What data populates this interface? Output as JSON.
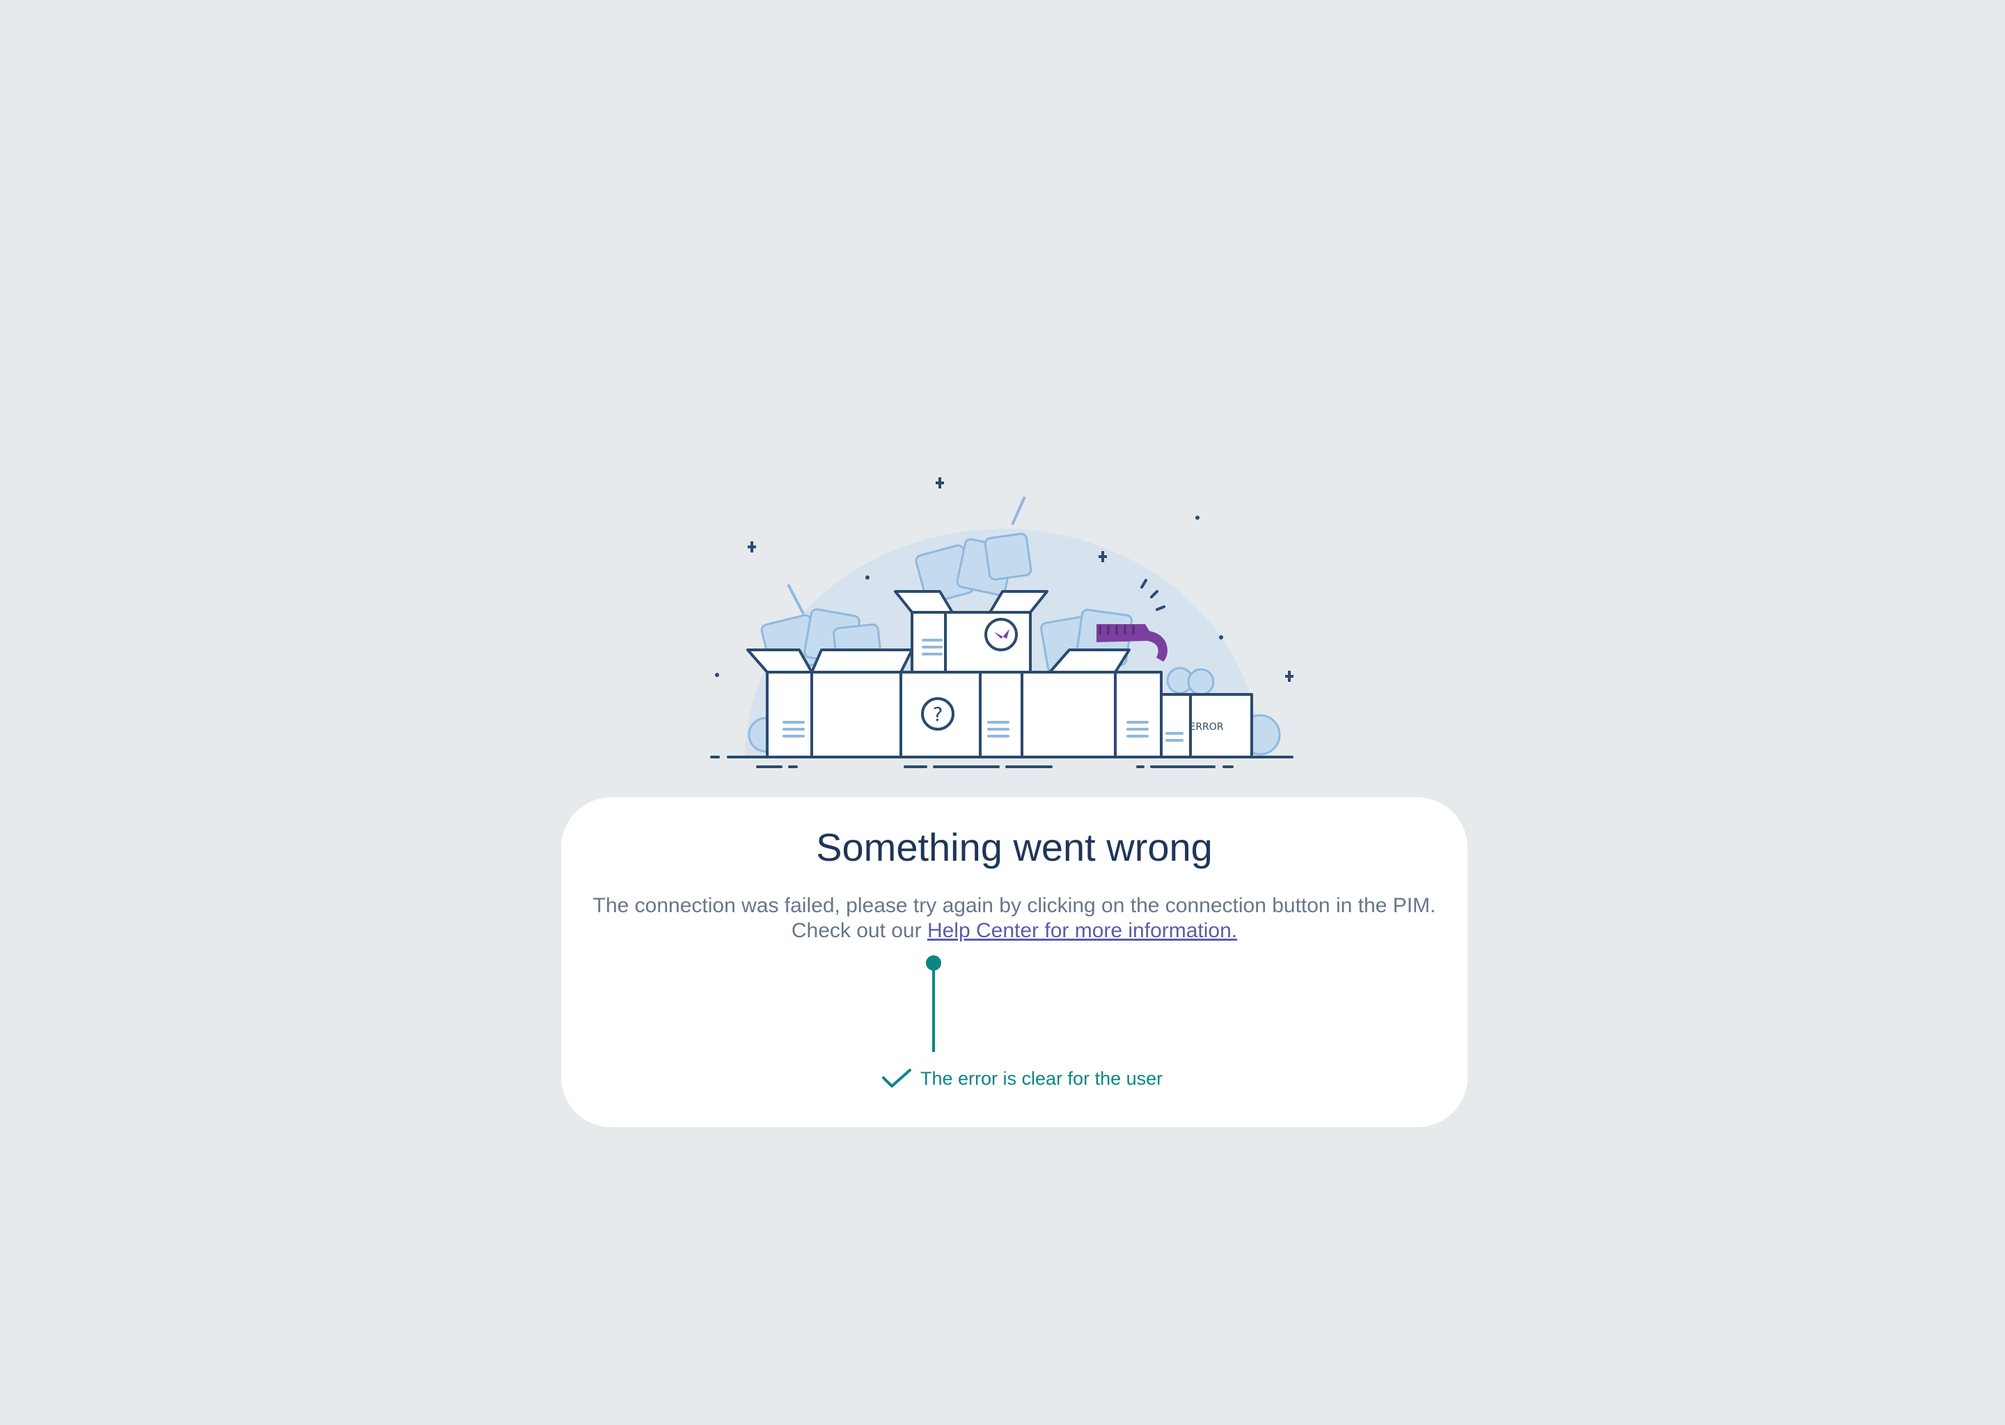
{
  "illustration": {
    "box_label": "ERROR",
    "icon": "boxes-illustration",
    "colors": {
      "outline": "#2b4a6e",
      "light": "#a7c8e6",
      "accent": "#7b3f9e",
      "halo": "#d6e3ee"
    }
  },
  "card": {
    "title": "Something went wrong",
    "message_line1": "The connection was failed, please try again by clicking on the connection button  in the PIM.",
    "message_line2_prefix": "Check out our ",
    "help_link": "Help Center for more information."
  },
  "annotation": {
    "text": "The error is clear for the user",
    "icon": "check-icon",
    "color": "#0b8684"
  }
}
